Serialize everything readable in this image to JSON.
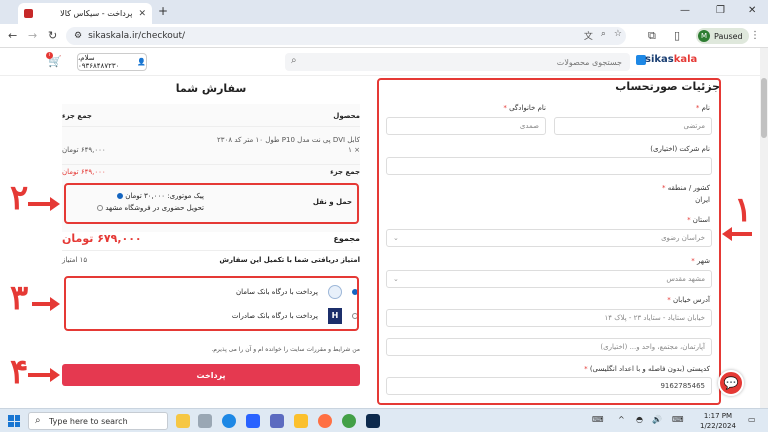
{
  "browser": {
    "tab_title": "پرداخت - سیکاس کالا",
    "url": "sikaskala.ir/checkout/",
    "profile_initial": "M",
    "profile_status": "Paused"
  },
  "site": {
    "logo_text_main": "sikas",
    "logo_text_accent": "kala",
    "search_placeholder": "جستجوی محصولات",
    "user_greeting": "سلام، ۰۹۳۶۸۴۸۷۲۳۰",
    "cart_count": "۱"
  },
  "billing": {
    "title": "جزئیات صورتحساب",
    "first_name_label": "نام",
    "first_name_value": "مرتضی",
    "last_name_label": "نام خانوادگی",
    "last_name_value": "صمدی",
    "company_label": "نام شرکت (اختیاری)",
    "country_label": "کشور / منطقه",
    "country_value": "ایران",
    "province_label": "استان",
    "province_value": "خراسان رضوی",
    "city_label": "شهر",
    "city_value": "مشهد مقدس",
    "street_label": "آدرس خیابان",
    "street_value": "خیابان ستایاد - ستایاد ۲۳ - پلاک ۱۴",
    "street_placeholder2": "آپارتمان، مجتمع، واحد و... (اختیاری)",
    "postcode_label": "کدپستی (بدون فاصله و با اعداد انگلیسی)",
    "postcode_value": "9162785465",
    "required_mark": "*"
  },
  "order": {
    "title": "سفارش شما",
    "col_product": "محصول",
    "col_subtotal": "جمع جزء",
    "product_name": "کابل DVI پی نت مدل P10 طول ۱۰ متر کد ۲۳۰۸",
    "product_qty": "× ۱",
    "product_price": "۶۴۹,۰۰۰ تومان",
    "subtotal_label": "جمع جزء",
    "subtotal_value": "۶۴۹,۰۰۰ تومان",
    "shipping_label": "حمل و نقل",
    "shipping_opt1": "پیک موتوری: ۳۰,۰۰۰ تومان",
    "shipping_opt2": "تحویل حضوری در فروشگاه مشهد",
    "total_label": "مجموع",
    "total_value": "۶۷۹,۰۰۰ تومان",
    "points_label": "امتیاز دریافتی شما با تکمیل این سفارش",
    "points_value": "۱۵ امتیاز",
    "pay_opt1": "پرداخت با درگاه بانک سامان",
    "pay_opt2": "پرداخت با درگاه بانک صادرات",
    "terms_text": "من شرایط و مقررات سایت را خوانده ام و آن را می پذیرم.",
    "pay_button": "پرداخت"
  },
  "annotations": {
    "n1": "۱",
    "n2": "۲",
    "n3": "۳",
    "n4": "۴"
  },
  "taskbar": {
    "search_placeholder": "Type here to search",
    "time": "1:17 PM",
    "date": "1/22/2024"
  },
  "colors": {
    "annotation_red": "#e53935",
    "pay_button": "#e53950"
  }
}
